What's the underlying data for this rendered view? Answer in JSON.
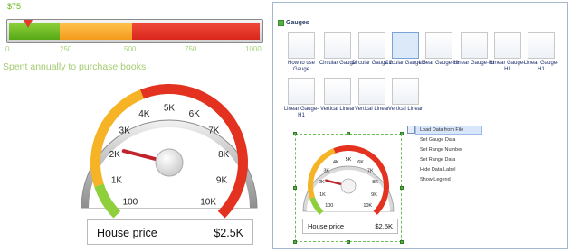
{
  "linear_gauge": {
    "value_label": "$75",
    "ticks": [
      "0",
      "250",
      "500",
      "750",
      "1000"
    ],
    "value_fraction": 0.075,
    "caption": "Spent annually to purchase books",
    "colors": {
      "low": "#6cb41e",
      "mid": "#f5a623",
      "high": "#e0251b"
    }
  },
  "main_gauge": {
    "ticks": [
      "100",
      "1K",
      "2K",
      "3K",
      "4K",
      "5K",
      "6K",
      "7K",
      "8K",
      "9K",
      "10K"
    ],
    "label_name": "House price",
    "label_value": "$2.5K",
    "value_fraction": 0.22
  },
  "panel": {
    "title": "Gauges",
    "thumbnails": [
      {
        "label": "How to use Gauge"
      },
      {
        "label": "Circular Gauge"
      },
      {
        "label": "Circular Gauge 2"
      },
      {
        "label": "Circular Gauge 3"
      },
      {
        "label": "Linear Gauge-Hr"
      },
      {
        "label": "Linear Gauge-Hr"
      },
      {
        "label": "Linear Gauge-H1"
      },
      {
        "label": "Linear Gauge-H1"
      },
      {
        "label": "Linear Gauge-H1"
      },
      {
        "label": "Vertical Linear"
      },
      {
        "label": "Vertical Linear"
      },
      {
        "label": "Vertical Linear"
      }
    ],
    "context_menu": [
      "Load Data from File",
      "Set Gauge Data",
      "Set Range Number",
      "Set Range Data",
      "Hide Data Label",
      "Show Legend"
    ],
    "small_gauge": {
      "ticks": [
        "100",
        "1K",
        "2K",
        "3K",
        "4K",
        "5K",
        "6K",
        "7K",
        "8K",
        "9K",
        "10K"
      ],
      "label_name": "House price",
      "label_value": "$2.5K"
    }
  }
}
